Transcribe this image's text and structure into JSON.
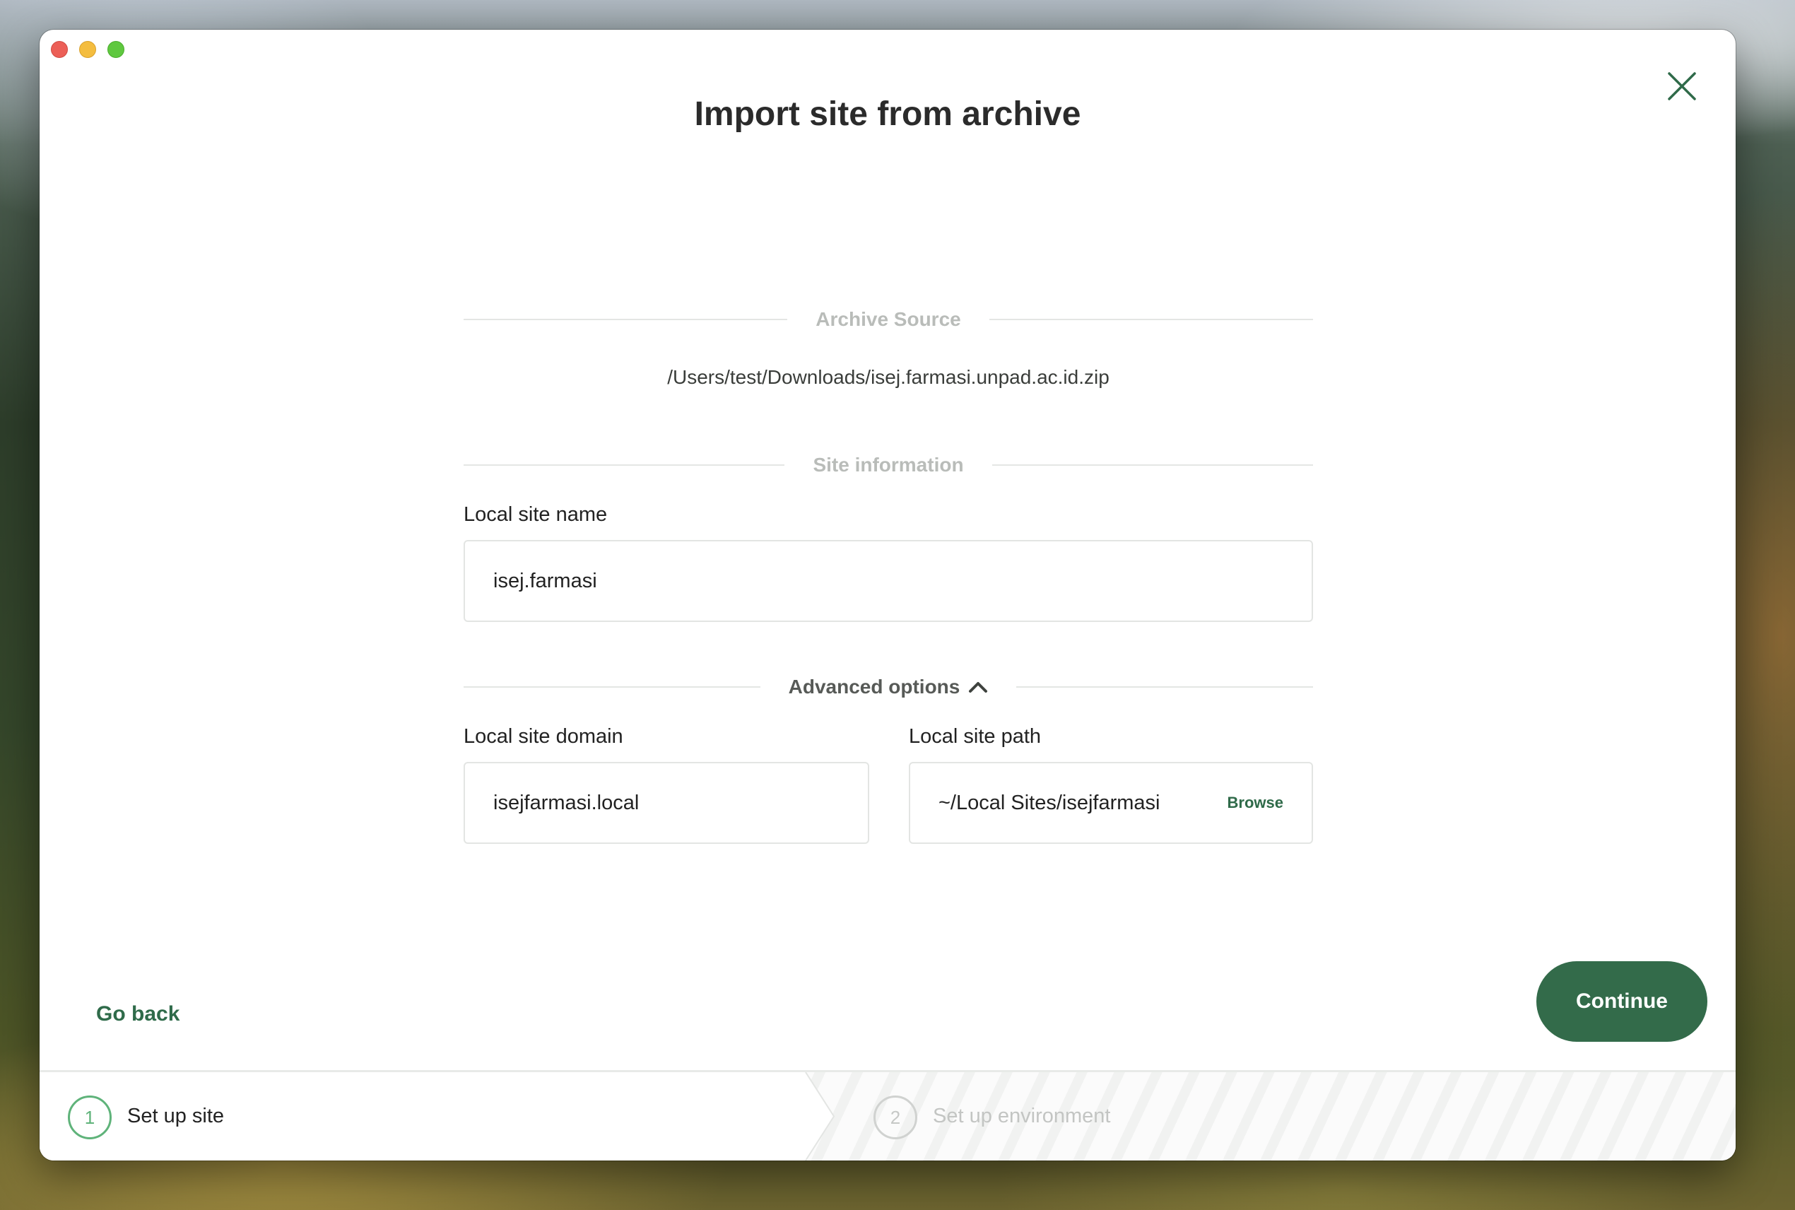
{
  "window": {
    "title": "Import site from archive"
  },
  "sections": {
    "archive_source": "Archive Source",
    "site_information": "Site information",
    "advanced_options": "Advanced options"
  },
  "archive": {
    "path": "/Users/test/Downloads/isej.farmasi.unpad.ac.id.zip"
  },
  "fields": {
    "site_name_label": "Local site name",
    "site_name_value": "isej.farmasi",
    "domain_label": "Local site domain",
    "domain_value": "isejfarmasi.local",
    "path_label": "Local site path",
    "path_value": "~/Local Sites/isejfarmasi",
    "browse_label": "Browse"
  },
  "actions": {
    "go_back": "Go back",
    "continue": "Continue"
  },
  "steps": [
    {
      "number": "1",
      "label": "Set up site",
      "active": true
    },
    {
      "number": "2",
      "label": "Set up environment",
      "active": false
    }
  ],
  "colors": {
    "accent": "#336b4a",
    "step_active": "#5fb37a"
  },
  "icons": {
    "close": "close-icon",
    "advanced_toggle": "chevron-up-icon"
  }
}
